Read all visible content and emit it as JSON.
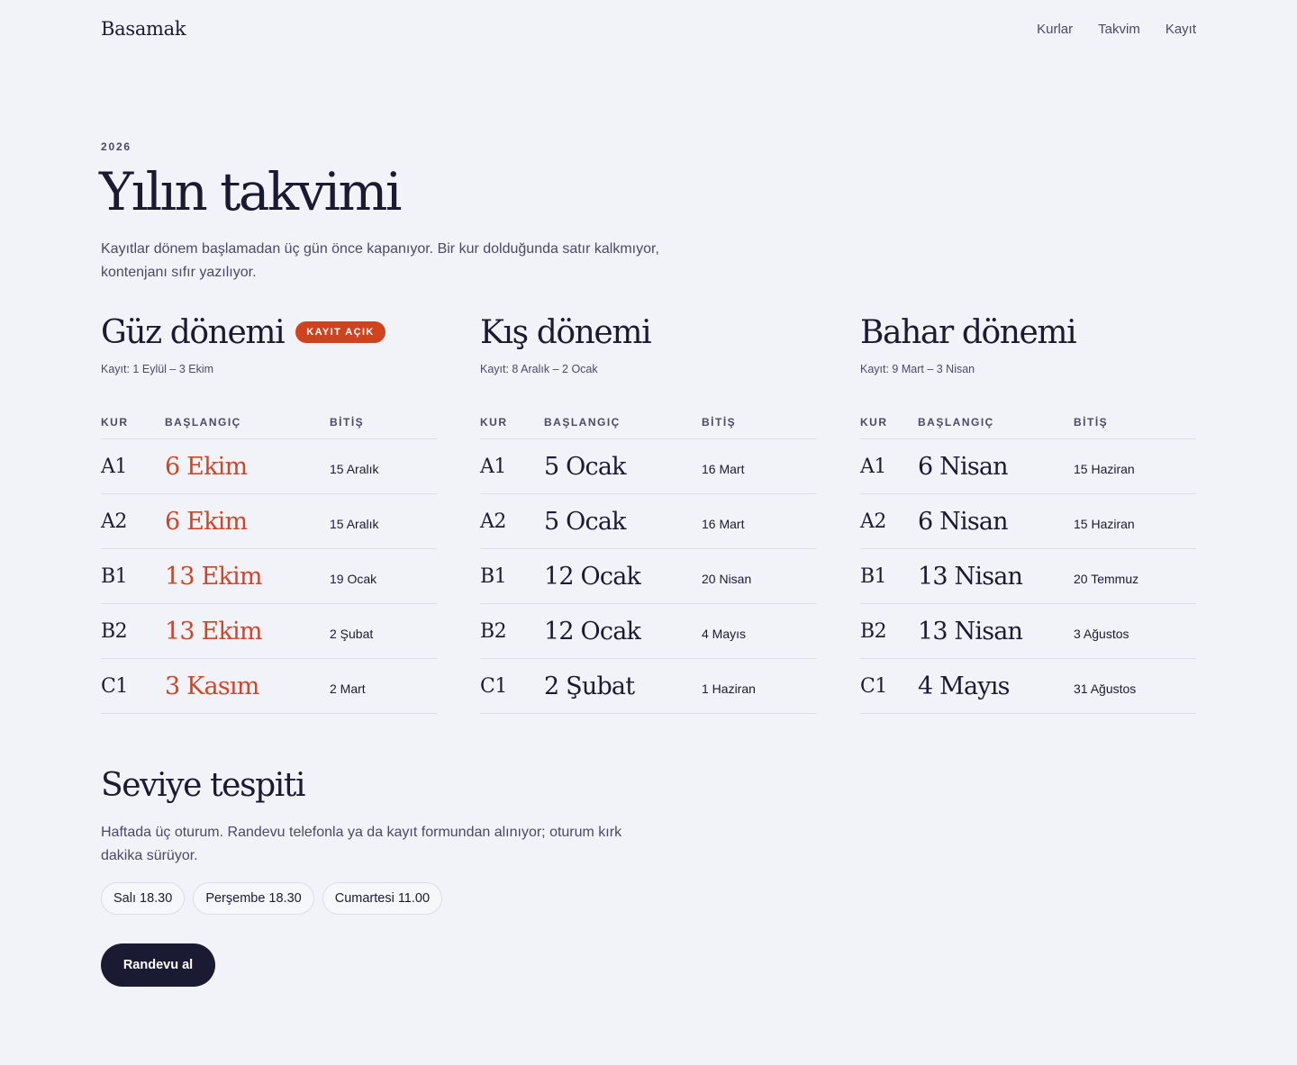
{
  "header": {
    "brand": "Basamak",
    "nav": [
      "Kurlar",
      "Takvim",
      "Kayıt"
    ]
  },
  "hero": {
    "eyebrow": "2026",
    "title": "Yılın takvimi",
    "intro": "Kayıtlar dönem başlamadan üç gün önce kapanıyor. Bir kur dolduğunda satır kalkmıyor, kontenjanı sıfır yazılıyor."
  },
  "columns": {
    "level": "KUR",
    "start": "BAŞLANGIÇ",
    "end": "BİTİŞ"
  },
  "terms": [
    {
      "title": "Güz dönemi",
      "badge": "KAYIT AÇIK",
      "range": "Kayıt: 1 Eylül – 3 Ekim",
      "rows": [
        {
          "level": "A1",
          "start": "6 Ekim",
          "end": "15 Aralık"
        },
        {
          "level": "A2",
          "start": "6 Ekim",
          "end": "15 Aralık"
        },
        {
          "level": "B1",
          "start": "13 Ekim",
          "end": "19 Ocak"
        },
        {
          "level": "B2",
          "start": "13 Ekim",
          "end": "2 Şubat"
        },
        {
          "level": "C1",
          "start": "3 Kasım",
          "end": "2 Mart"
        }
      ]
    },
    {
      "title": "Kış dönemi",
      "badge": "",
      "range": "Kayıt: 8 Aralık – 2 Ocak",
      "rows": [
        {
          "level": "A1",
          "start": "5 Ocak",
          "end": "16 Mart"
        },
        {
          "level": "A2",
          "start": "5 Ocak",
          "end": "16 Mart"
        },
        {
          "level": "B1",
          "start": "12 Ocak",
          "end": "20 Nisan"
        },
        {
          "level": "B2",
          "start": "12 Ocak",
          "end": "4 Mayıs"
        },
        {
          "level": "C1",
          "start": "2 Şubat",
          "end": "1 Haziran"
        }
      ]
    },
    {
      "title": "Bahar dönemi",
      "badge": "",
      "range": "Kayıt: 9 Mart – 3 Nisan",
      "rows": [
        {
          "level": "A1",
          "start": "6 Nisan",
          "end": "15 Haziran"
        },
        {
          "level": "A2",
          "start": "6 Nisan",
          "end": "15 Haziran"
        },
        {
          "level": "B1",
          "start": "13 Nisan",
          "end": "20 Temmuz"
        },
        {
          "level": "B2",
          "start": "13 Nisan",
          "end": "3 Ağustos"
        },
        {
          "level": "C1",
          "start": "4 Mayıs",
          "end": "31 Ağustos"
        }
      ]
    }
  ],
  "placement": {
    "title": "Seviye tespiti",
    "text": "Haftada üç oturum. Randevu telefonla ya da kayıt formundan alınıyor; oturum kırk dakika sürüyor.",
    "slots": [
      "Salı 18.30",
      "Perşembe 18.30",
      "Cumartesi 11.00"
    ],
    "cta": "Randevu al"
  },
  "colors": {
    "background": "#f2f3f9",
    "ink": "#1b1a33",
    "muted": "#4a4968",
    "accent": "#cf4526",
    "badge": "#d0431f"
  }
}
